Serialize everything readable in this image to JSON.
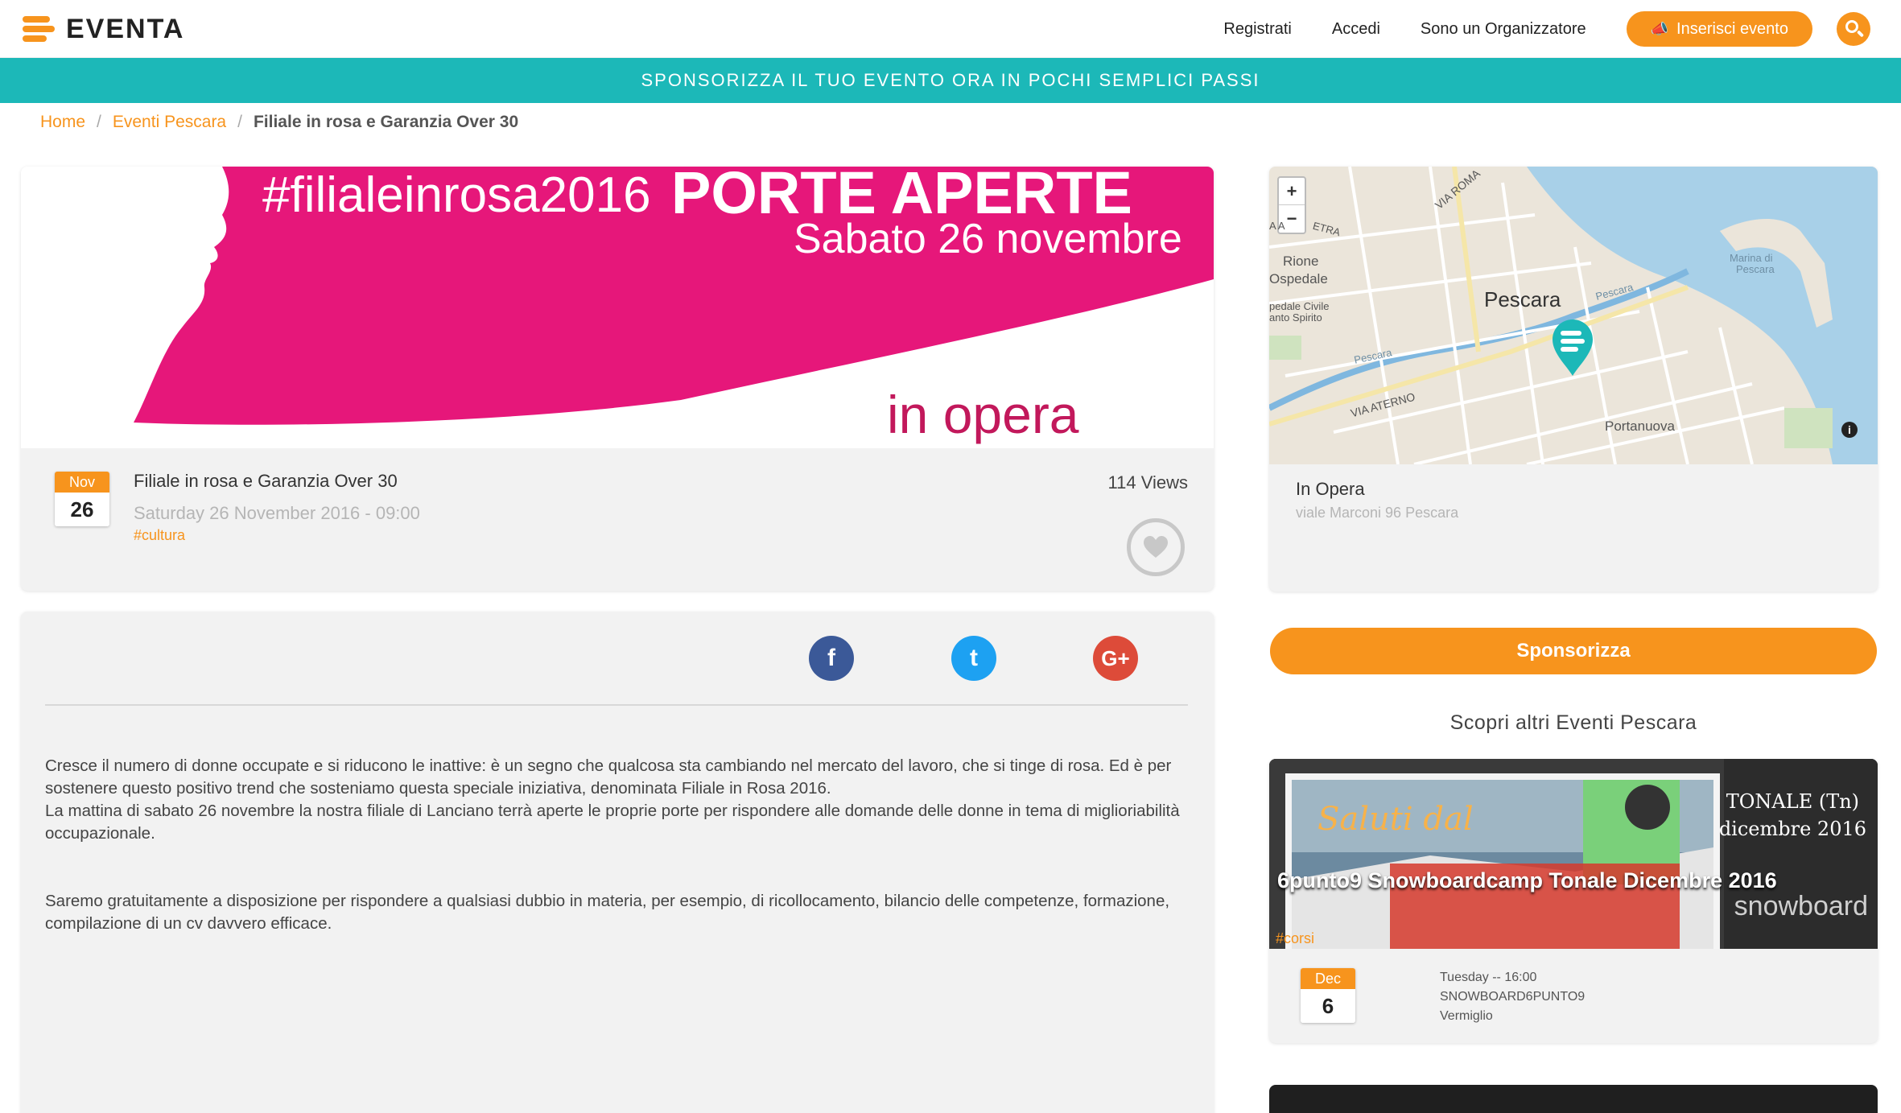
{
  "brand": {
    "name": "EVENTA",
    "accent": "#f7941d",
    "teal": "#1cb8b8"
  },
  "nav": {
    "register": "Registrati",
    "login": "Accedi",
    "organizer": "Sono un Organizzatore",
    "insert_event": "Inserisci evento"
  },
  "icons": {
    "megaphone": "megaphone-icon",
    "search": "search-icon",
    "heart": "heart-icon"
  },
  "banner": "SPONSORIZZA IL TUO EVENTO ORA IN POCHI SEMPLICI PASSI",
  "breadcrumb": {
    "home": "Home",
    "category": "Eventi Pescara",
    "current": "Filiale in rosa e Garanzia Over 30"
  },
  "event_image": {
    "hashtag": "#filialeinrosa2016",
    "headline": "PORTE APERTE",
    "date_line": "Sabato 26 novembre",
    "venue_line": "in opera"
  },
  "event": {
    "month": "Nov",
    "day": "26",
    "title": "Filiale in rosa e Garanzia Over 30",
    "datetime": "Saturday 26 November 2016 - 09:00",
    "tag": "#cultura",
    "views": "114 Views"
  },
  "social": {
    "facebook": "f",
    "twitter": "t",
    "google": "G+"
  },
  "description": {
    "p1a": "Cresce il numero di donne occupate e si riducono le inattive: è un segno che qualcosa sta cambiando nel mercato del lavoro, che si tinge di rosa. Ed è per sostenere questo positivo trend che sosteniamo questa speciale iniziativa, denominata Filiale in Rosa 2016.",
    "p1b": "La mattina di sabato 26 novembre la nostra filiale di Lanciano terrà aperte le proprie porte per rispondere alle domande delle donne in tema di miglioriabilità occupazionale.",
    "p2": "Saremo gratuitamente a disposizione per rispondere a qualsiasi dubbio in materia, per esempio, di ricollocamento, bilancio delle competenze, formazione, compilazione di un cv davvero efficace."
  },
  "map": {
    "city": "Pescara",
    "zoom_in": "+",
    "zoom_out": "−",
    "info": "i",
    "labels": {
      "via_roma": "VIA ROMA",
      "etra": "ETRA",
      "aa": "A A",
      "rione": "Rione",
      "ospedale": "Ospedale",
      "ped_civile": "pedale Civile",
      "santo_spirito": "anto Spirito",
      "marina1": "Marina di",
      "marina2": "Pescara",
      "river1": "Pescara",
      "river2": "Pescara",
      "via_aterno": "VIA ATERNO",
      "portanuova": "Portanuova"
    }
  },
  "venue": {
    "name": "In Opera",
    "address": "viale Marconi 96 Pescara"
  },
  "sponsor_button": "Sponsorizza",
  "other_events": {
    "title": "Scopri altri Eventi Pescara",
    "items": [
      {
        "title": "6punto9 Snowboardcamp Tonale Dicembre 2016",
        "place_line1": "TONALE (Tn)",
        "place_line2": "dicembre 2016",
        "img_script": "Saluti dal",
        "img_snow": "snowboard",
        "tag": "#corsi",
        "month": "Dec",
        "day": "6",
        "when": "Tuesday -- 16:00",
        "organizer": "SNOWBOARD6PUNTO9",
        "location": "Vermiglio"
      }
    ]
  }
}
